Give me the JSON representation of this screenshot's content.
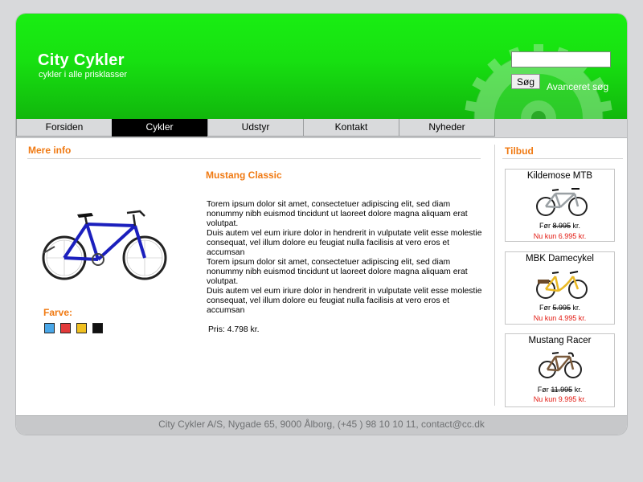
{
  "brand": {
    "title": "City Cykler",
    "tagline": "cykler i alle prisklasser"
  },
  "search": {
    "value": "",
    "placeholder": "",
    "button_label": "Søg",
    "advanced_label": "Avanceret søg"
  },
  "nav": [
    {
      "label": "Forsiden",
      "active": false
    },
    {
      "label": "Cykler",
      "active": true
    },
    {
      "label": "Udstyr",
      "active": false
    },
    {
      "label": "Kontakt",
      "active": false
    },
    {
      "label": "Nyheder",
      "active": false
    }
  ],
  "main": {
    "section_title": "Mere info",
    "product": {
      "title": "Mustang Classic",
      "paragraphs": [
        "Torem ipsum dolor sit amet, consectetuer adipiscing elit, sed diam nonummy nibh euismod tincidunt ut laoreet dolore magna aliquam erat volutpat.",
        "Duis autem vel eum iriure dolor in hendrerit in vulputate velit esse molestie consequat, vel illum dolore eu feugiat nulla facilisis at vero eros et accumsan",
        "Torem ipsum dolor sit amet, consectetuer adipiscing elit, sed diam nonummy nibh euismod tincidunt ut laoreet dolore magna aliquam erat volutpat.",
        "Duis autem vel eum iriure dolor in hendrerit in vulputate velit esse molestie consequat, vel illum dolore eu feugiat nulla facilisis at vero eros et accumsan"
      ],
      "price": "Pris: 4.798 kr.",
      "color_label": "Farve:",
      "colors": [
        "#4aa7e8",
        "#e23a3a",
        "#f0c020",
        "#111111"
      ]
    }
  },
  "offers": {
    "title": "Tilbud",
    "items": [
      {
        "name": "Kildemose MTB",
        "before_prefix": "Før",
        "before_price": "8.995",
        "before_suffix": "kr.",
        "now": "Nu kun 6.995 kr.",
        "frame_color": "#9aa0a4"
      },
      {
        "name": "MBK Damecykel",
        "before_prefix": "Før",
        "before_price": "5.995",
        "before_suffix": "kr.",
        "now": "Nu kun 4.995 kr.",
        "frame_color": "#e9b824"
      },
      {
        "name": "Mustang Racer",
        "before_prefix": "Før",
        "before_price": "11.995",
        "before_suffix": "kr.",
        "now": "Nu kun 9.995 kr.",
        "frame_color": "#7a5a3c"
      }
    ]
  },
  "footer": {
    "text": "City Cykler A/S, Nygade 65, 9000 Ålborg, (+45 ) 98 10 10 11, contact@cc.dk"
  },
  "colors": {
    "accent": "#f07a13",
    "header_green": "#17e011",
    "sale_red": "#e2170f"
  }
}
